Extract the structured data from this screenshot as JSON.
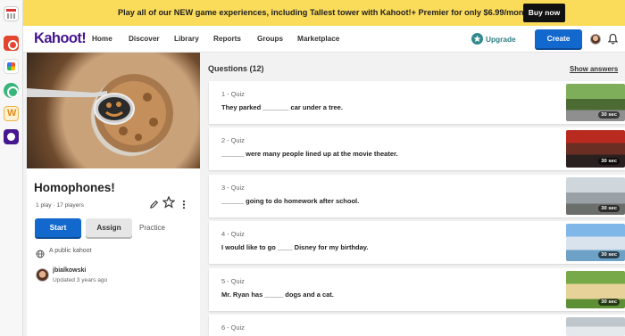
{
  "banner": {
    "text": "Play all of our NEW game experiences, including Tallest tower with Kahoot!+ Premier for only $6.99/month",
    "cta": "Buy now"
  },
  "nav": {
    "logo": "Kahoot!",
    "links": [
      "Home",
      "Discover",
      "Library",
      "Reports",
      "Groups",
      "Marketplace"
    ],
    "upgrade": "Upgrade",
    "create": "Create"
  },
  "kahoot": {
    "title": "Homophones!",
    "meta": "1 play · 17 players",
    "start": "Start",
    "assign": "Assign",
    "practice": "Practice",
    "visibility": "A public kahoot",
    "creator": "jbialkowski",
    "updated": "Updated 3 years ago"
  },
  "questions": {
    "heading": "Questions (12)",
    "show_answers": "Show answers",
    "items": [
      {
        "label": "1 - Quiz",
        "text": "They parked _______ car under a tree.",
        "time": "30 sec"
      },
      {
        "label": "2 - Quiz",
        "text": "______ were many people lined up at the movie theater.",
        "time": "30 sec"
      },
      {
        "label": "3 - Quiz",
        "text": "______ going to do homework after school.",
        "time": "30 sec"
      },
      {
        "label": "4 - Quiz",
        "text": "I would like to go ____ Disney for my birthday.",
        "time": "30 sec"
      },
      {
        "label": "5 - Quiz",
        "text": "Mr. Ryan has _____ dogs and a cat.",
        "time": "30 sec"
      },
      {
        "label": "6 - Quiz",
        "text": "",
        "time": ""
      }
    ]
  },
  "colors": {
    "banner_bg": "#fbdb5a",
    "brand_purple": "#46178f",
    "primary_blue": "#1368ce",
    "upgrade_teal": "#2f7f83"
  },
  "icons": [
    "calendar-app-icon",
    "dock-app-icon",
    "star-icon",
    "edit-icon",
    "more-icon",
    "bell-icon",
    "globe-icon"
  ]
}
